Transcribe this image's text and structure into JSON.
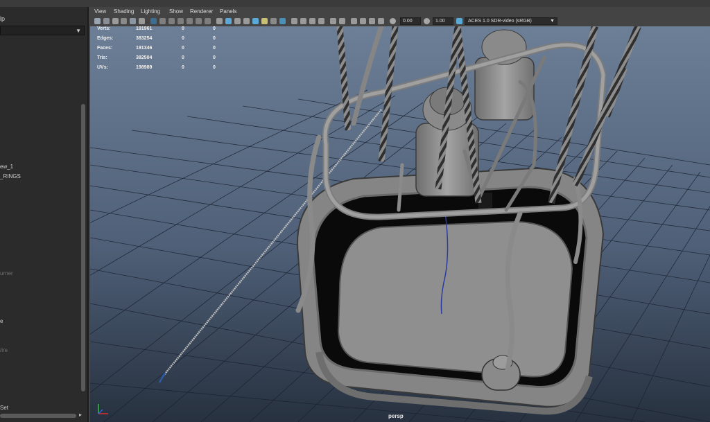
{
  "outliner": {
    "help_label": "lp",
    "items": [
      {
        "label": "ew_1",
        "dim": false
      },
      {
        "label": "_RINGS",
        "dim": false
      },
      {
        "label": "urner",
        "dim": true
      },
      {
        "label": "e",
        "dim": false
      },
      {
        "label": "/ire",
        "dim": true
      },
      {
        "label": "Set",
        "dim": false
      }
    ]
  },
  "viewport_menu": [
    "View",
    "Shading",
    "Lighting",
    "Show",
    "Renderer",
    "Panels"
  ],
  "toolbar": {
    "exposure_value": "0.00",
    "gamma_value": "1.00",
    "color_space": "ACES 1.0 SDR-video (sRGB)"
  },
  "hud": {
    "rows": [
      {
        "label": "Verts:",
        "total": "191961",
        "selected": "0",
        "triangles": "0"
      },
      {
        "label": "Edges:",
        "total": "383254",
        "selected": "0",
        "triangles": "0"
      },
      {
        "label": "Faces:",
        "total": "191346",
        "selected": "0",
        "triangles": "0"
      },
      {
        "label": "Tris:",
        "total": "382504",
        "selected": "0",
        "triangles": "0"
      },
      {
        "label": "UVs:",
        "total": "198989",
        "selected": "0",
        "triangles": "0"
      }
    ]
  },
  "camera_label": "persp",
  "colors": {
    "background_top": "#6c7f97",
    "background_bottom": "#27313f",
    "grid": "#111820",
    "model_gray": "#8c8c8c",
    "selection_blue": "#5aa9d6"
  },
  "icons": [
    "camera-icon",
    "grid-icon",
    "wireframe-icon",
    "shaded-icon",
    "texture-icon",
    "light-icon",
    "shadow-icon",
    "isolate-icon",
    "xray-icon",
    "color-management-icon"
  ]
}
